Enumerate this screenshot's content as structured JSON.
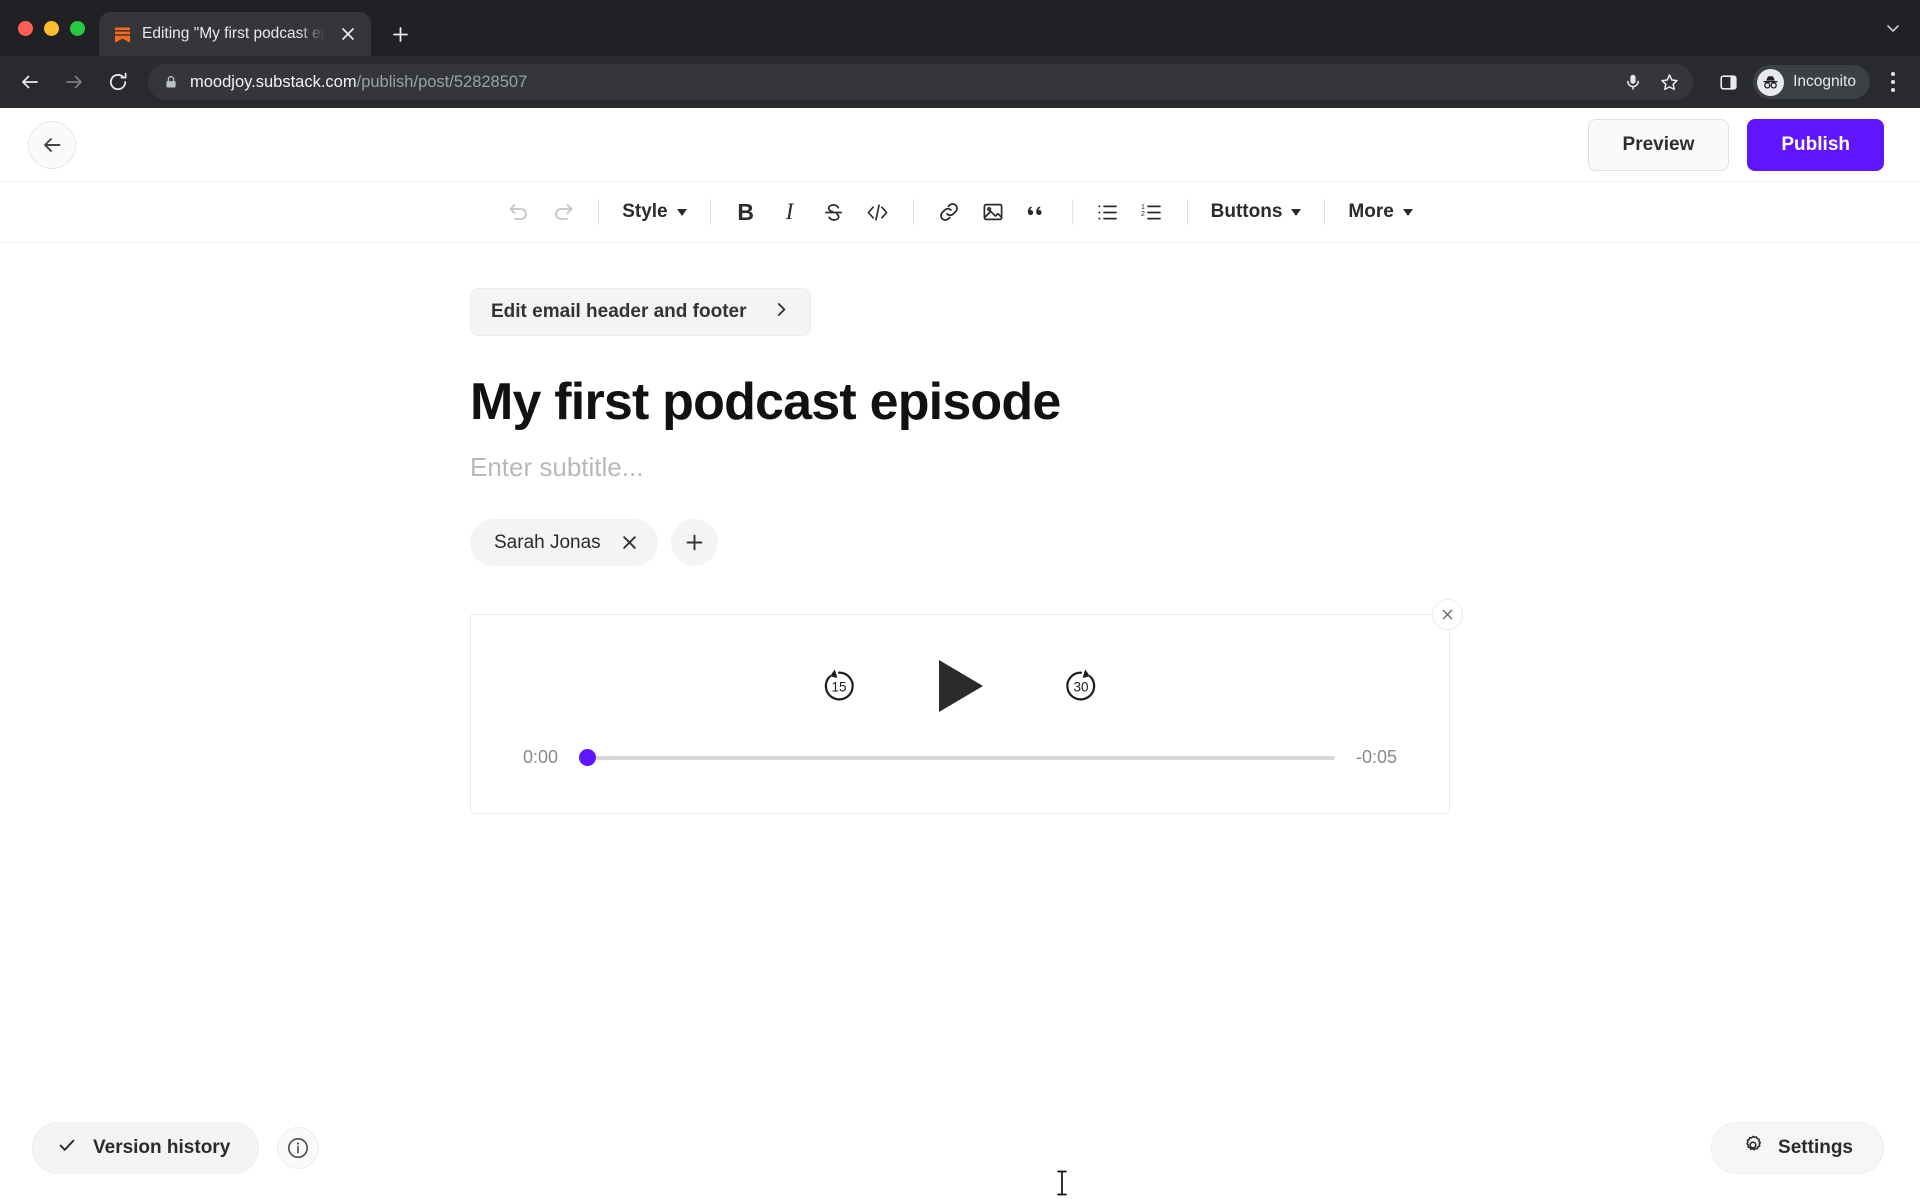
{
  "browser": {
    "tab": {
      "title": "Editing \"My first podcast episo",
      "favicon": "substack-bookmark-icon",
      "close_icon": "close-icon"
    },
    "new_tab_icon": "plus-icon",
    "tab_list_icon": "chevron-down-icon",
    "nav": {
      "back_icon": "back-arrow-icon",
      "forward_icon": "forward-arrow-icon",
      "reload_icon": "reload-icon"
    },
    "omnibox": {
      "lock_icon": "lock-icon",
      "url_host": "moodjoy.substack.com",
      "url_path": "/publish/post/52828507",
      "mic_icon": "microphone-icon",
      "bookmark_icon": "star-icon"
    },
    "side_panel_icon": "side-panel-icon",
    "profile": {
      "avatar_icon": "incognito-icon",
      "label": "Incognito"
    },
    "menu_icon": "kebab-menu-icon"
  },
  "header": {
    "back_icon": "back-arrow-icon",
    "preview_label": "Preview",
    "publish_label": "Publish",
    "publish_color": "#6015ff"
  },
  "toolbar": {
    "undo_icon": "undo-icon",
    "redo_icon": "redo-icon",
    "style_label": "Style",
    "bold_label": "B",
    "italic_label": "I",
    "strikethrough_icon": "strikethrough-icon",
    "code_label": "</>",
    "link_icon": "link-icon",
    "image_icon": "image-icon",
    "quote_icon": "blockquote-icon",
    "bullet_list_icon": "bullet-list-icon",
    "numbered_list_icon": "numbered-list-icon",
    "buttons_label": "Buttons",
    "more_label": "More"
  },
  "editor": {
    "email_header_label": "Edit email header and footer",
    "email_header_chevron": "chevron-right-icon",
    "title": "My first podcast episode",
    "subtitle_placeholder": "Enter subtitle...",
    "authors": [
      {
        "name": "Sarah Jonas",
        "remove_icon": "close-icon"
      }
    ],
    "add_author_icon": "plus-icon"
  },
  "audio_player": {
    "close_icon": "close-icon",
    "skip_back_label": "15",
    "skip_back_icon": "rewind-15-icon",
    "play_icon": "play-icon",
    "skip_forward_label": "30",
    "skip_forward_icon": "forward-30-icon",
    "current_time": "0:00",
    "remaining_time": "-0:05",
    "progress_percent": 0,
    "accent_color": "#6015ff"
  },
  "footer": {
    "version_history_label": "Version history",
    "version_history_icon": "check-icon",
    "info_icon": "info-icon",
    "settings_label": "Settings",
    "settings_icon": "gear-icon"
  },
  "cursor": {
    "icon": "text-cursor-icon"
  }
}
